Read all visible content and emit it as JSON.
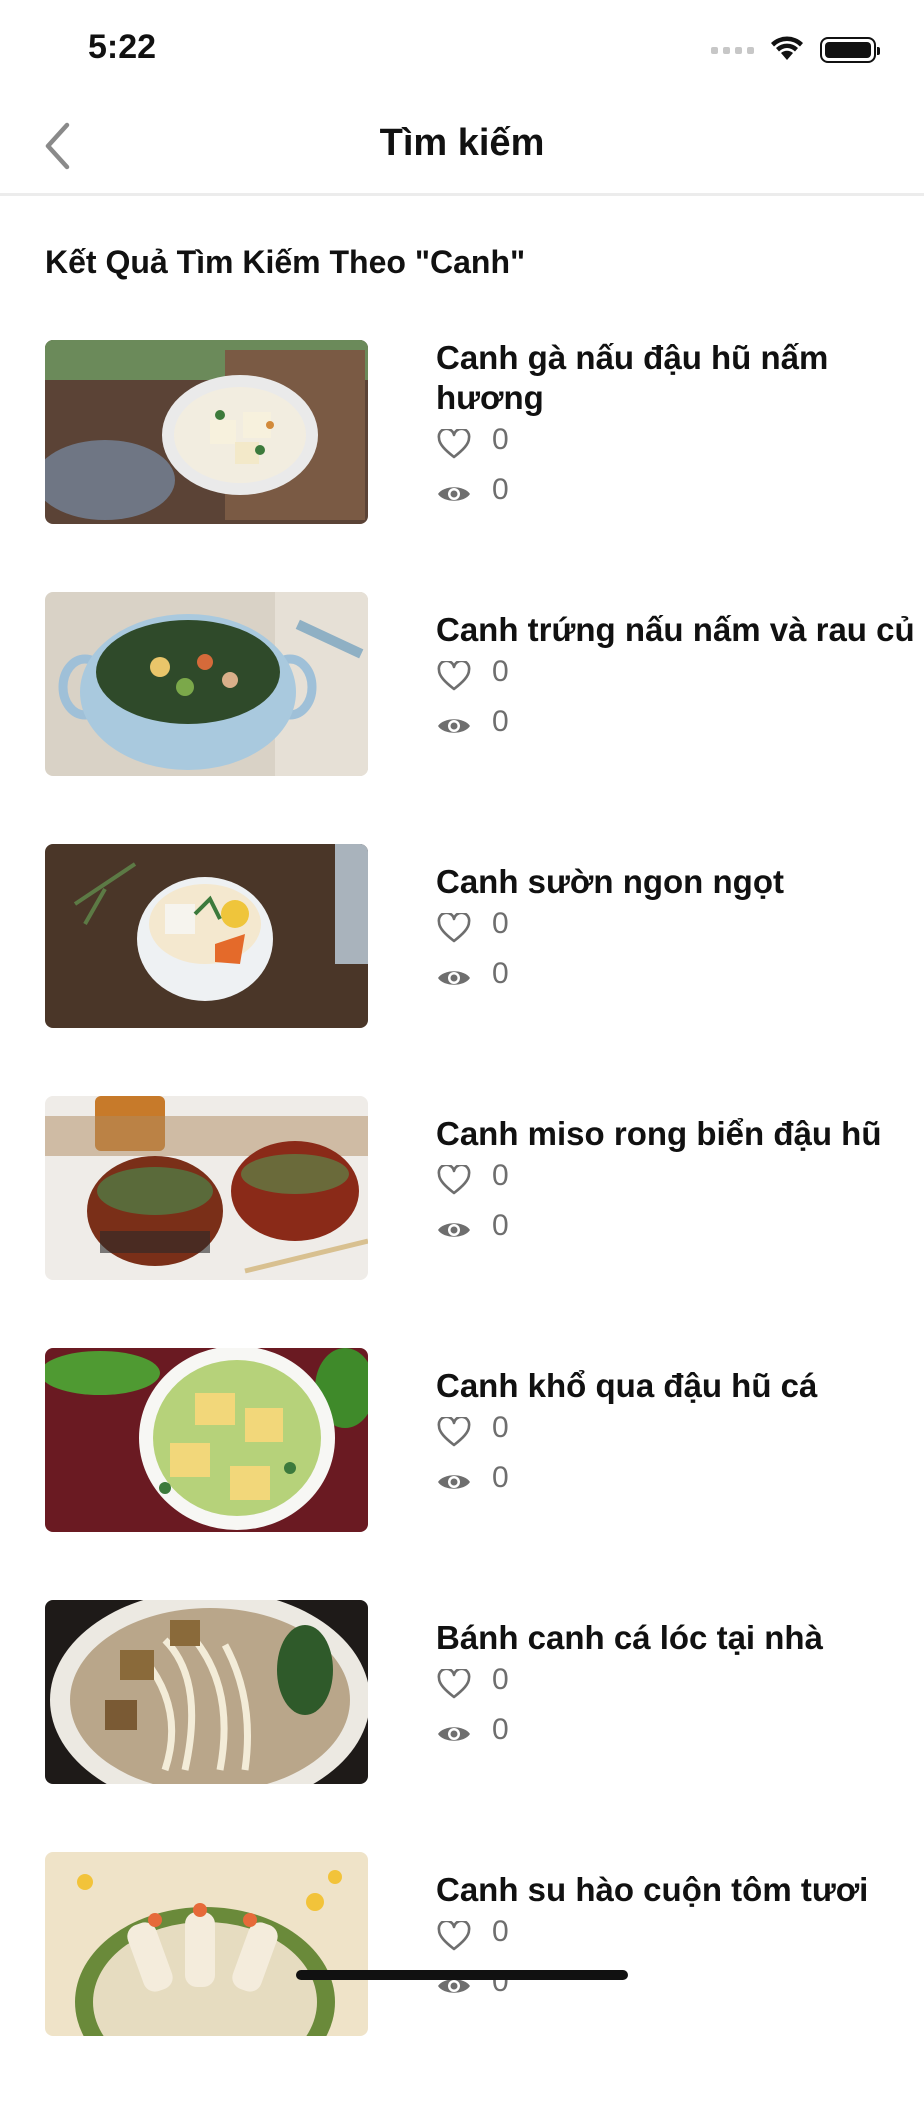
{
  "status": {
    "time": "5:22"
  },
  "nav": {
    "title": "Tìm kiếm",
    "back_icon": "chevron-left-icon"
  },
  "results_heading": "Kết Quả Tìm Kiếm Theo \"Canh\"",
  "items": [
    {
      "title": "Canh gà nấu đậu hũ nấm hương",
      "likes": "0",
      "views": "0"
    },
    {
      "title": "Canh trứng nấu nấm và rau củ",
      "likes": "0",
      "views": "0"
    },
    {
      "title": "Canh sườn ngon ngọt",
      "likes": "0",
      "views": "0"
    },
    {
      "title": "Canh miso rong biển đậu hũ",
      "likes": "0",
      "views": "0"
    },
    {
      "title": "Canh khổ qua đậu hũ cá",
      "likes": "0",
      "views": "0"
    },
    {
      "title": "Bánh canh cá lóc tại nhà",
      "likes": "0",
      "views": "0"
    },
    {
      "title": "Canh su hào cuộn tôm tươi",
      "likes": "0",
      "views": "0"
    }
  ],
  "icons": {
    "like": "heart-icon",
    "views": "eye-icon"
  },
  "colors": {
    "text": "#111111",
    "muted": "#6e6e6e",
    "divider": "#ececec"
  }
}
